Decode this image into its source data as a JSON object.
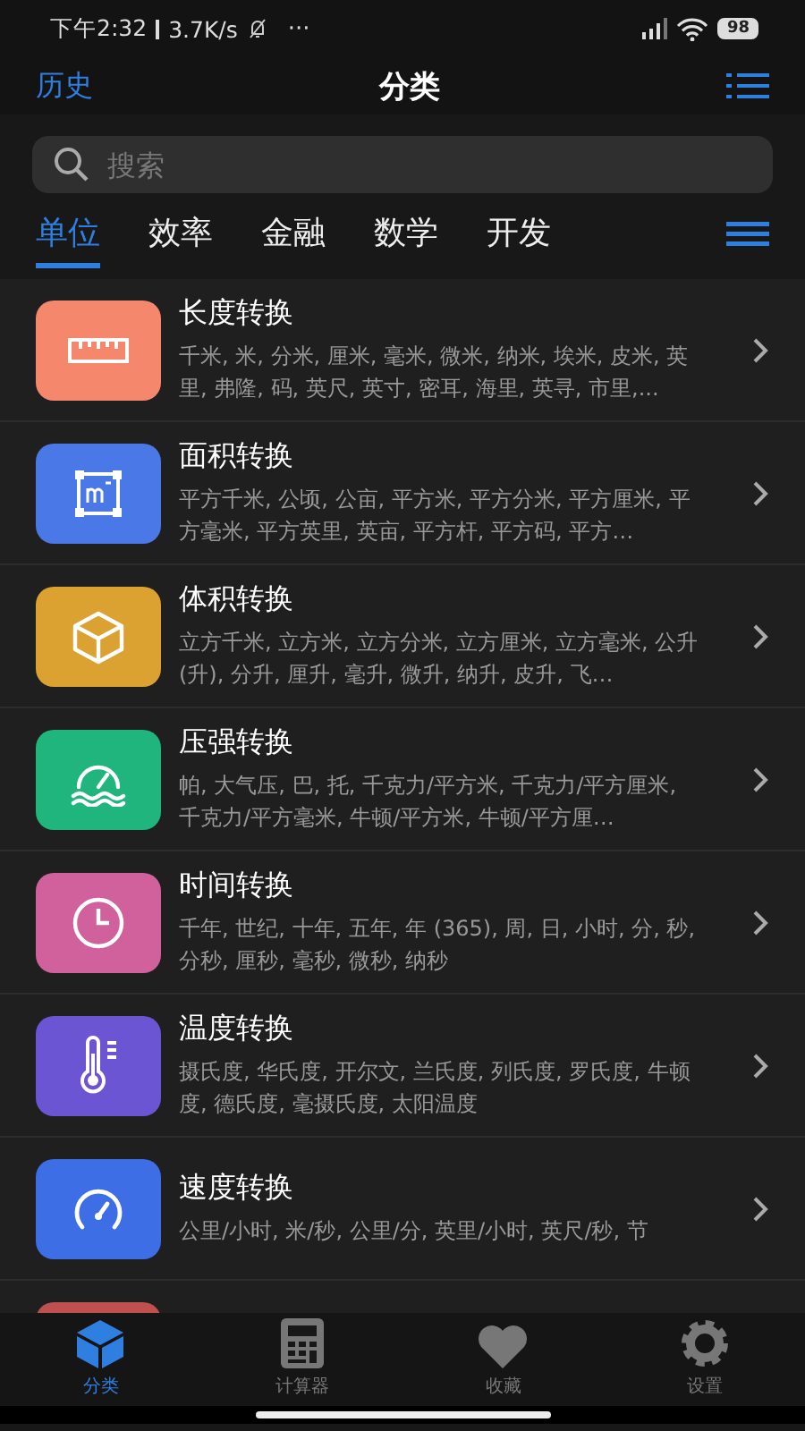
{
  "status_bar": {
    "time": "下午2:32",
    "speed": "3.7K/s",
    "more": "···",
    "battery": "98"
  },
  "header": {
    "left": "历史",
    "title": "分类"
  },
  "search": {
    "placeholder": "搜索"
  },
  "tabs": [
    {
      "label": "单位",
      "selected": true
    },
    {
      "label": "效率",
      "selected": false
    },
    {
      "label": "金融",
      "selected": false
    },
    {
      "label": "数学",
      "selected": false
    },
    {
      "label": "开发",
      "selected": false
    }
  ],
  "items": [
    {
      "kind": "ruler",
      "color": "#f5876c",
      "title": "长度转换",
      "desc": "千米, 米, 分米, 厘米, 毫米, 微米, 纳米, 埃米, 皮米, 英里, 弗隆, 码, 英尺, 英寸, 密耳, 海里, 英寻, 市里,..."
    },
    {
      "kind": "area",
      "color": "#4a78e6",
      "title": "面积转换",
      "desc": "平方千米, 公顷, 公亩, 平方米, 平方分米, 平方厘米, 平方毫米, 平方英里, 英亩, 平方杆, 平方码, 平方…"
    },
    {
      "kind": "cube",
      "color": "#dba232",
      "title": "体积转换",
      "desc": "立方千米, 立方米, 立方分米, 立方厘米, 立方毫米, 公升 (升), 分升, 厘升, 毫升, 微升, 纳升, 皮升, 飞…"
    },
    {
      "kind": "gauge",
      "color": "#1fb57c",
      "title": "压强转换",
      "desc": "帕, 大气压, 巴, 托, 千克力/平方米, 千克力/平方厘米, 千克力/平方毫米, 牛顿/平方米, 牛顿/平方厘…"
    },
    {
      "kind": "clock",
      "color": "#d0619c",
      "title": "时间转换",
      "desc": "千年, 世纪, 十年, 五年, 年 (365), 周, 日, 小时, 分, 秒, 分秒, 厘秒, 毫秒, 微秒, 纳秒"
    },
    {
      "kind": "thermo",
      "color": "#6b55d2",
      "title": "温度转换",
      "desc": "摄氏度, 华氏度, 开尔文, 兰氏度, 列氏度, 罗氏度, 牛顿度, 德氏度, 毫摄氏度, 太阳温度"
    },
    {
      "kind": "speed",
      "color": "#3d6ee6",
      "title": "速度转换",
      "desc": "公里/小时, 米/秒, 公里/分, 英里/小时, 英尺/秒, 节"
    },
    {
      "kind": "partial",
      "color": "#c0504d"
    }
  ],
  "nav": [
    {
      "kind": "cube",
      "label": "分类",
      "selected": true
    },
    {
      "kind": "calc",
      "label": "计算器",
      "selected": false
    },
    {
      "kind": "heart",
      "label": "收藏",
      "selected": false
    },
    {
      "kind": "gear",
      "label": "设置",
      "selected": false
    }
  ]
}
